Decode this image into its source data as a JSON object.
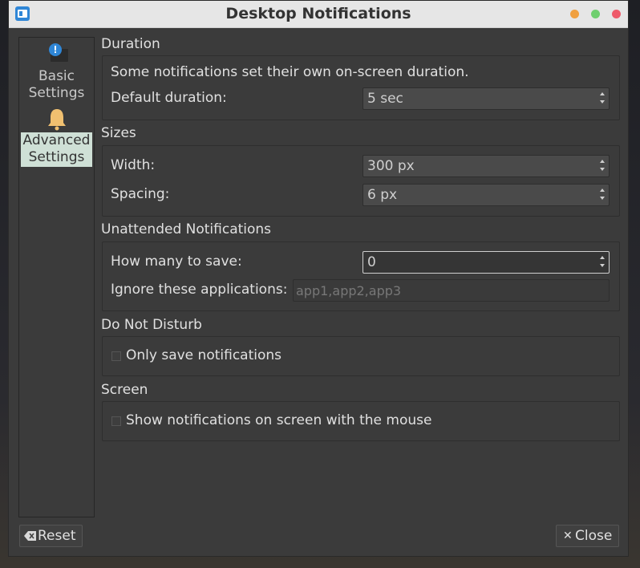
{
  "window": {
    "title": "Desktop Notifications"
  },
  "sidebar": {
    "items": [
      {
        "label_line1": "Basic",
        "label_line2": "Settings",
        "icon": "info-badge-icon"
      },
      {
        "label_line1": "Advanced",
        "label_line2": "Settings",
        "icon": "bell-icon",
        "selected": true
      }
    ]
  },
  "duration": {
    "title": "Duration",
    "note": "Some notifications set their own on-screen duration.",
    "default_label": "Default duration:",
    "default_value": "5 sec"
  },
  "sizes": {
    "title": "Sizes",
    "width_label": "Width:",
    "width_value": "300 px",
    "spacing_label": "Spacing:",
    "spacing_value": "6 px"
  },
  "unattended": {
    "title": "Unattended Notifications",
    "save_label": "How many to save:",
    "save_value": "0",
    "ignore_label": "Ignore these applications:",
    "ignore_placeholder": "app1,app2,app3"
  },
  "dnd": {
    "title": "Do Not Disturb",
    "only_save_label": "Only save notifications",
    "only_save_checked": false
  },
  "screen": {
    "title": "Screen",
    "mouse_label": "Show notifications on screen with the mouse",
    "mouse_checked": false
  },
  "buttons": {
    "reset_label": "Reset",
    "close_label": "Close"
  },
  "colors": {
    "window_bg": "#3b3b3b",
    "titlebar_bg": "#e6e6e6",
    "selected_item_bg": "#cfe0d6",
    "bell_color": "#f0c070",
    "info_color": "#2f86d6"
  }
}
